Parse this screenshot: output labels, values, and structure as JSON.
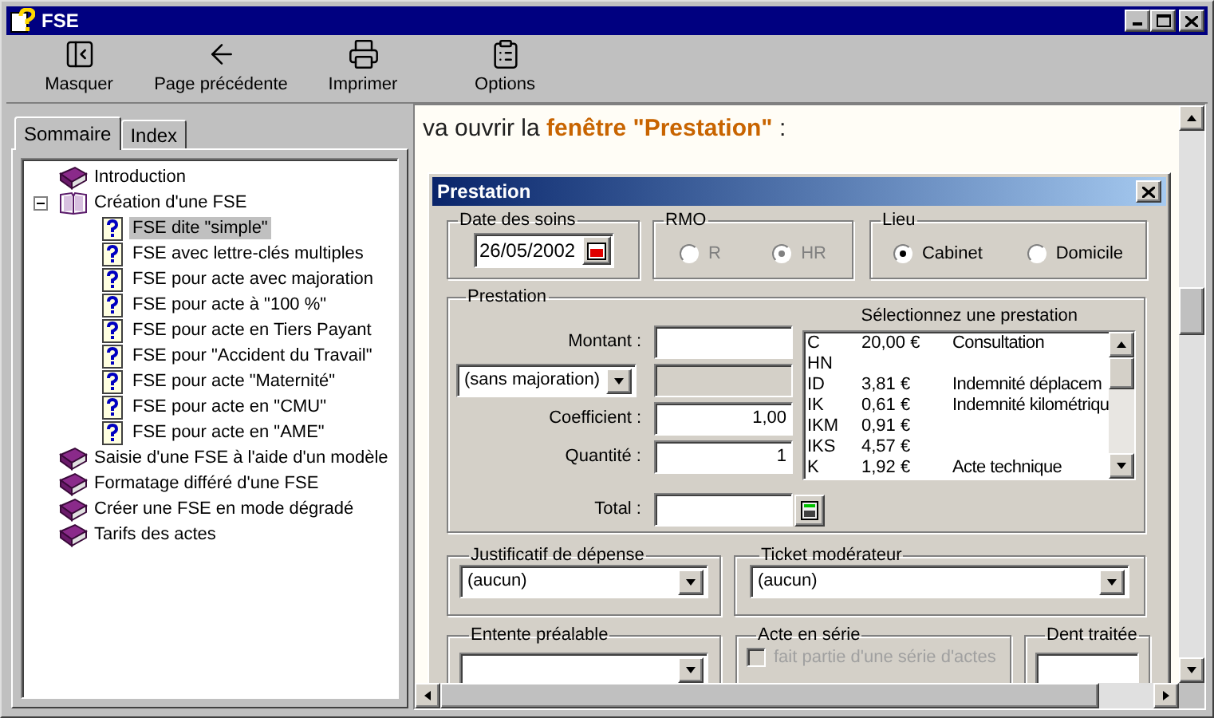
{
  "window": {
    "title": "FSE"
  },
  "toolbar": [
    {
      "label": "Masquer",
      "kind": "hide"
    },
    {
      "label": "Page précédente",
      "kind": "back"
    },
    {
      "label": "Imprimer",
      "kind": "print"
    },
    {
      "label": "Options",
      "kind": "options"
    }
  ],
  "tabs": [
    {
      "label": "Sommaire",
      "selected": true
    },
    {
      "label": "Index",
      "selected": false
    }
  ],
  "tree": [
    {
      "label": "Introduction",
      "kind": "book",
      "selected": false
    },
    {
      "label": "Création d'une FSE",
      "kind": "book",
      "selected": false,
      "expanded": true,
      "children": [
        {
          "label": "FSE dite \"simple\"",
          "kind": "page",
          "selected": true
        },
        {
          "label": "FSE avec lettre-clés multiples",
          "kind": "page",
          "selected": false
        },
        {
          "label": "FSE pour acte avec majoration",
          "kind": "page",
          "selected": false
        },
        {
          "label": "FSE pour acte à \"100 %\"",
          "kind": "page",
          "selected": false
        },
        {
          "label": "FSE pour acte en Tiers Payant",
          "kind": "page",
          "selected": false
        },
        {
          "label": "FSE pour  \"Accident du Travail\"",
          "kind": "page",
          "selected": false
        },
        {
          "label": "FSE pour acte \"Maternité\"",
          "kind": "page",
          "selected": false
        },
        {
          "label": "FSE pour acte en \"CMU\"",
          "kind": "page",
          "selected": false
        },
        {
          "label": "FSE pour acte en \"AME\"",
          "kind": "page",
          "selected": false
        }
      ]
    },
    {
      "label": "Saisie d'une FSE à l'aide d'un modèle",
      "kind": "book",
      "selected": false
    },
    {
      "label": "Formatage différé d'une FSE",
      "kind": "book",
      "selected": false
    },
    {
      "label": "Créer une FSE en mode dégradé",
      "kind": "book",
      "selected": false
    },
    {
      "label": "Tarifs des actes",
      "kind": "book",
      "selected": false
    }
  ],
  "content": {
    "intro": "va ouvrir la **fenêtre \"Prestation\"** :"
  },
  "dialog": {
    "title": "Prestation",
    "date": {
      "legend": "Date des soins",
      "value": "26/05/2002"
    },
    "rmo": {
      "legend": "RMO",
      "disabled": true,
      "options": [
        {
          "label": "R",
          "selected": false
        },
        {
          "label": "HR",
          "selected": true
        }
      ]
    },
    "lieu": {
      "legend": "Lieu",
      "disabled": false,
      "options": [
        {
          "label": "Cabinet",
          "selected": true
        },
        {
          "label": "Domicile",
          "selected": false
        }
      ]
    },
    "prestation": {
      "legend": "Prestation",
      "montant_label": "Montant :",
      "majoration": "(sans majoration)",
      "coefficient_label": "Coefficient :",
      "coefficient": "1,00",
      "quantite_label": "Quantité :",
      "quantite": "1",
      "total_label": "Total :",
      "list_title": "Sélectionnez une prestation",
      "list": [
        {
          "code": "C",
          "price": "20,00 €",
          "label": "Consultation"
        },
        {
          "code": "HN"
        },
        {
          "code": "ID",
          "price": "3,81 €",
          "label": "Indemnité déplacem"
        },
        {
          "code": "IK",
          "price": "0,61 €",
          "label": "Indemnité kilométriqu"
        },
        {
          "code": "IKM",
          "price": "0,91 €"
        },
        {
          "code": "IKS",
          "price": "4,57 €"
        },
        {
          "code": "K",
          "price": "1,92 €",
          "label": "Acte technique"
        }
      ]
    },
    "justificatif": {
      "legend": "Justificatif de dépense",
      "value": "(aucun)"
    },
    "ticket": {
      "legend": "Ticket modérateur",
      "value": "(aucun)"
    },
    "entente": {
      "legend": "Entente préalable"
    },
    "serie": {
      "legend": "Acte en série",
      "checkbox": {
        "label": "fait partie d'une série d'actes",
        "checked": false,
        "disabled": true
      }
    },
    "dent": {
      "legend": "Dent traitée"
    }
  }
}
